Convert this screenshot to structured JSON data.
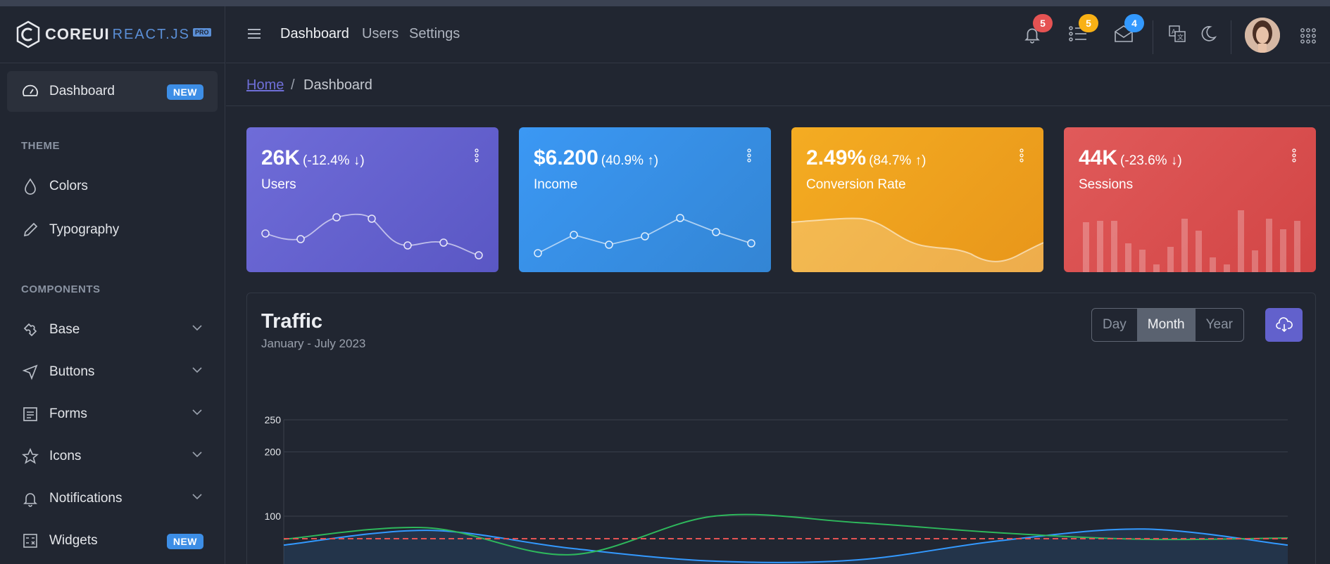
{
  "brand": {
    "word": "COREUI",
    "sub": "REACT.JS",
    "pro": "PRO"
  },
  "sidebar": {
    "items": [
      {
        "label": "Dashboard",
        "badge": "NEW",
        "icon": "speedometer-icon"
      },
      {
        "label": "Colors",
        "icon": "drop-icon"
      },
      {
        "label": "Typography",
        "icon": "pencil-icon"
      },
      {
        "label": "Base",
        "icon": "puzzle-icon"
      },
      {
        "label": "Buttons",
        "icon": "cursor-icon"
      },
      {
        "label": "Forms",
        "icon": "notes-icon"
      },
      {
        "label": "Icons",
        "icon": "star-icon"
      },
      {
        "label": "Notifications",
        "icon": "bell-icon"
      },
      {
        "label": "Widgets",
        "badge": "NEW",
        "icon": "calculator-icon"
      }
    ],
    "sections": {
      "theme": "THEME",
      "components": "COMPONENTS"
    }
  },
  "header": {
    "nav": [
      "Dashboard",
      "Users",
      "Settings"
    ],
    "badges": {
      "notifications": "5",
      "tasks": "5",
      "messages": "4"
    },
    "colors": {
      "notifications": "#e55353",
      "tasks": "#f9b115",
      "messages": "#3399ff"
    }
  },
  "breadcrumb": {
    "home": "Home",
    "sep": "/",
    "current": "Dashboard"
  },
  "widgets": [
    {
      "value": "26K",
      "change": "(-12.4% ↓)",
      "label": "Users",
      "color": "#6261cc"
    },
    {
      "value": "$6.200",
      "change": "(40.9% ↑)",
      "label": "Income",
      "color": "#3399ff"
    },
    {
      "value": "2.49%",
      "change": "(84.7% ↑)",
      "label": "Conversion Rate",
      "color": "#f9b115"
    },
    {
      "value": "44K",
      "change": "(-23.6% ↓)",
      "label": "Sessions",
      "color": "#e55353"
    }
  ],
  "traffic": {
    "title": "Traffic",
    "subtitle": "January - July 2023",
    "segments": [
      "Day",
      "Month",
      "Year"
    ],
    "selected": "Month"
  },
  "chart_data": {
    "type": "line",
    "yticks": [
      100,
      200,
      250
    ],
    "ylim": [
      0,
      250
    ],
    "grid": true,
    "series": [
      {
        "color": "#3399ff",
        "values": [
          55,
          78,
          50,
          30,
          32,
          62,
          80,
          55
        ],
        "filled": true
      },
      {
        "color": "#2eb85c",
        "values": [
          64,
          82,
          40,
          100,
          90,
          74,
          64,
          66
        ]
      },
      {
        "color": "#e55353",
        "values": [
          65,
          65,
          65,
          65,
          65,
          65,
          65,
          65
        ],
        "dashed": true
      }
    ]
  }
}
